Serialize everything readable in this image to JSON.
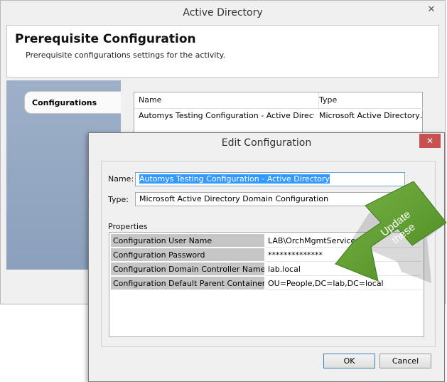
{
  "ad_window": {
    "title": "Active Directory",
    "close_glyph": "✕",
    "header_title": "Prerequisite Configuration",
    "header_subtitle": "Prerequisite configurations settings for the activity.",
    "tab_label": "Configurations",
    "grid": {
      "columns": [
        "Name",
        "Type"
      ],
      "rows": [
        [
          "Automys Testing Configuration - Active Directory",
          "Microsoft Active Directory…"
        ]
      ]
    }
  },
  "edit_dialog": {
    "title": "Edit Configuration",
    "close_glyph": "✕",
    "name_label": "Name:",
    "name_value": "Automys Testing Configuration - Active Directory",
    "type_label": "Type:",
    "type_value": "Microsoft Active Directory Domain Configuration",
    "properties_label": "Properties",
    "properties": [
      {
        "name": "Configuration User Name",
        "value": "LAB\\OrchMgmtService"
      },
      {
        "name": "Configuration Password",
        "value": "**************"
      },
      {
        "name": "Configuration Domain Controller Name (FQDN)",
        "value": "lab.local"
      },
      {
        "name": "Configuration Default Parent Container",
        "value": "OU=People,DC=lab,DC=local"
      }
    ],
    "ok_label": "OK",
    "cancel_label": "Cancel"
  },
  "callout": {
    "line1": "Update",
    "line2": "these",
    "color": "#5a9a2e"
  }
}
